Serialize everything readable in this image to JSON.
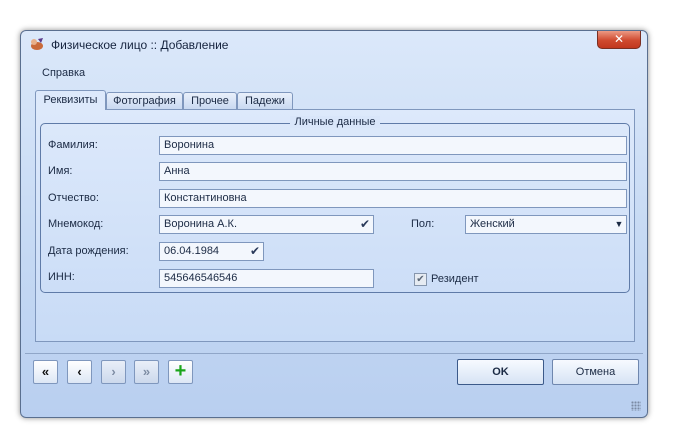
{
  "window": {
    "title": "Физическое лицо :: Добавление",
    "close_glyph": "✕"
  },
  "menu": {
    "help": "Справка"
  },
  "tabs": [
    {
      "label": "Реквизиты",
      "active": true
    },
    {
      "label": "Фотография",
      "active": false
    },
    {
      "label": "Прочее",
      "active": false
    },
    {
      "label": "Падежи",
      "active": false
    }
  ],
  "group": {
    "title": "Личные данные"
  },
  "form": {
    "last_name": {
      "label": "Фамилия:",
      "value": "Воронина"
    },
    "first_name": {
      "label": "Имя:",
      "value": "Анна"
    },
    "patronymic": {
      "label": "Отчество:",
      "value": "Константиновна"
    },
    "mnemocode": {
      "label": "Мнемокод:",
      "value": "Воронина А.К."
    },
    "gender": {
      "label": "Пол:",
      "value": "Женский"
    },
    "birth_date": {
      "label": "Дата рождения:",
      "value": "06.04.1984"
    },
    "inn": {
      "label": "ИНН:",
      "value": "545646546546"
    },
    "resident": {
      "label": "Резидент",
      "checked": true
    }
  },
  "nav": {
    "first": "«",
    "prev": "‹",
    "next": "›",
    "last": "»",
    "add": "+"
  },
  "buttons": {
    "ok": "OK",
    "cancel": "Отмена"
  },
  "colors": {
    "accent": "#c1371e",
    "add_green": "#1aa51a",
    "window_bg": "#c4d8f3"
  }
}
